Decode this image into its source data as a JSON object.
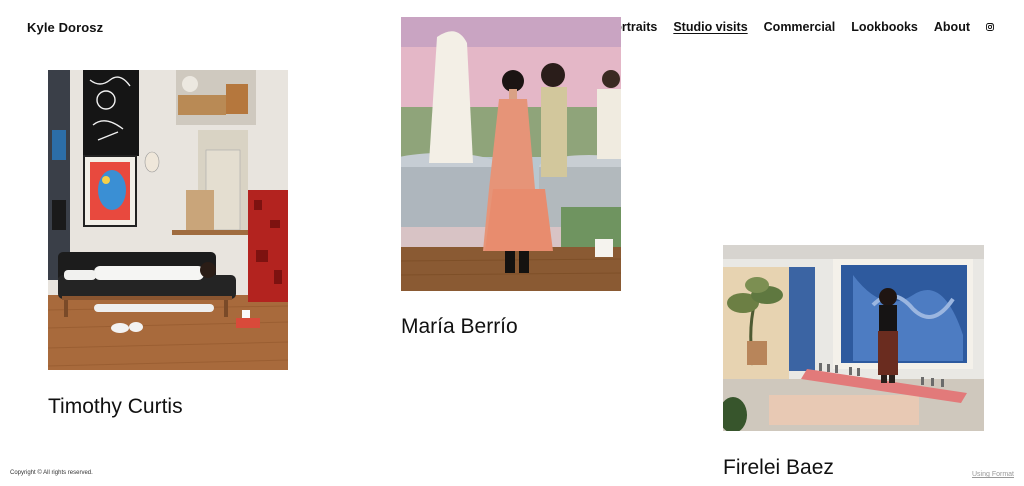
{
  "site": {
    "title": "Kyle Dorosz"
  },
  "nav": {
    "items": [
      {
        "label": "Portraits",
        "active": false
      },
      {
        "label": "Studio visits",
        "active": true
      },
      {
        "label": "Commercial",
        "active": false
      },
      {
        "label": "Lookbooks",
        "active": false
      },
      {
        "label": "About",
        "active": false
      }
    ],
    "social_icon": "instagram-icon"
  },
  "projects": [
    {
      "title": "Timothy Curtis"
    },
    {
      "title": "María Berrío"
    },
    {
      "title": "Firelei Baez"
    }
  ],
  "footer": {
    "copyright": "Copyright © All rights reserved.",
    "powered_by": "Using Format"
  },
  "colors": {
    "text": "#111111",
    "background": "#ffffff",
    "muted": "#999999"
  }
}
